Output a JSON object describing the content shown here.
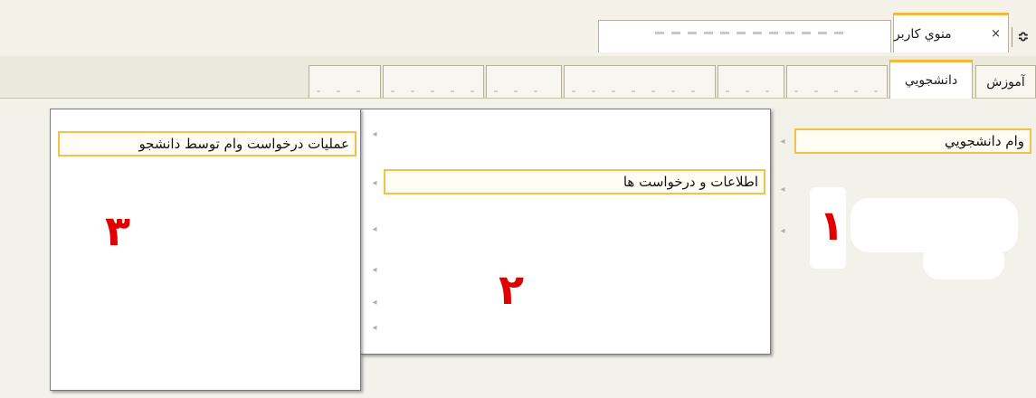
{
  "window_tabs": {
    "active_label": "منوي كاربر",
    "close_glyph": "×",
    "collapse_glyph": "≎",
    "second_tab_label": ""
  },
  "module_tabs": [
    {
      "label": "آموزش",
      "active": false
    },
    {
      "label": "دانشجويي",
      "active": true
    },
    {
      "label": "",
      "active": false
    },
    {
      "label": "",
      "active": false
    },
    {
      "label": "",
      "active": false
    },
    {
      "label": "",
      "active": false
    },
    {
      "label": "",
      "active": false
    },
    {
      "label": "",
      "active": false
    }
  ],
  "column1": {
    "items": [
      {
        "label": "وام دانشجويي",
        "selected": true
      },
      {
        "label": "",
        "selected": false
      },
      {
        "label": "",
        "selected": false
      }
    ],
    "annotation": "۱"
  },
  "column2": {
    "items": [
      {
        "label": "",
        "selected": false
      },
      {
        "label": "اطلاعات و درخواست ها",
        "selected": true
      },
      {
        "label": "",
        "selected": false
      },
      {
        "label": "",
        "selected": false
      },
      {
        "label": "",
        "selected": false
      },
      {
        "label": "",
        "selected": false
      }
    ],
    "annotation": "۲"
  },
  "column3": {
    "items": [
      {
        "label": "عمليات درخواست وام توسط دانشجو",
        "selected": true
      }
    ],
    "annotation": "۳"
  },
  "icons": {
    "submenu_arrow": "◂"
  },
  "colors": {
    "accent_border": "#f5b83a",
    "annotation_red": "#e00000",
    "panel_bg": "#f2f1ea"
  }
}
